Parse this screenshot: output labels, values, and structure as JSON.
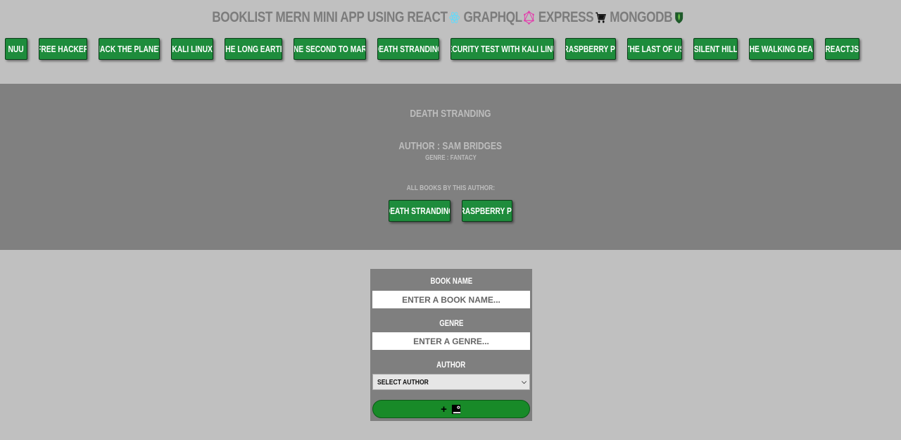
{
  "header": {
    "title_parts": [
      "BookList MERN Mini App using React",
      "GraphQL",
      "Express",
      "MongoDB"
    ],
    "icons": [
      "react-icon",
      "graphql-icon",
      "express-cart-icon",
      "mongodb-leaf-icon"
    ]
  },
  "book_list": [
    "NUU",
    "Free Hacker",
    "Hack The Planet",
    "Kali Linux",
    "The Long Earth",
    "One Second To Mars",
    "Death Stranding",
    "Security Test With Kali Linux",
    "Raspberry Pi",
    "The Last Of Us",
    "Silent Hill",
    "The Walking Dead",
    "ReactJS"
  ],
  "details": {
    "book_title": "Death Stranding",
    "author_line": "Author : Sam Bridges",
    "genre_line": "Genre : Fantacy",
    "all_books_label": "All Books by this author:",
    "author_books": [
      "Death Stranding",
      "Raspberry Pi"
    ]
  },
  "form": {
    "book_name_label": "Book Name",
    "book_name_placeholder": "ENTER A BOOK NAME...",
    "genre_label": "Genre",
    "genre_placeholder": "ENTER A GENRE...",
    "author_label": "Author",
    "author_select_value": "Select author",
    "submit_label": "+",
    "submit_icon": "book-icon"
  },
  "colors": {
    "background": "#c0c0c0",
    "panel": "#808080",
    "button_green": "#1e8c3c",
    "submit_green": "#188a28"
  }
}
